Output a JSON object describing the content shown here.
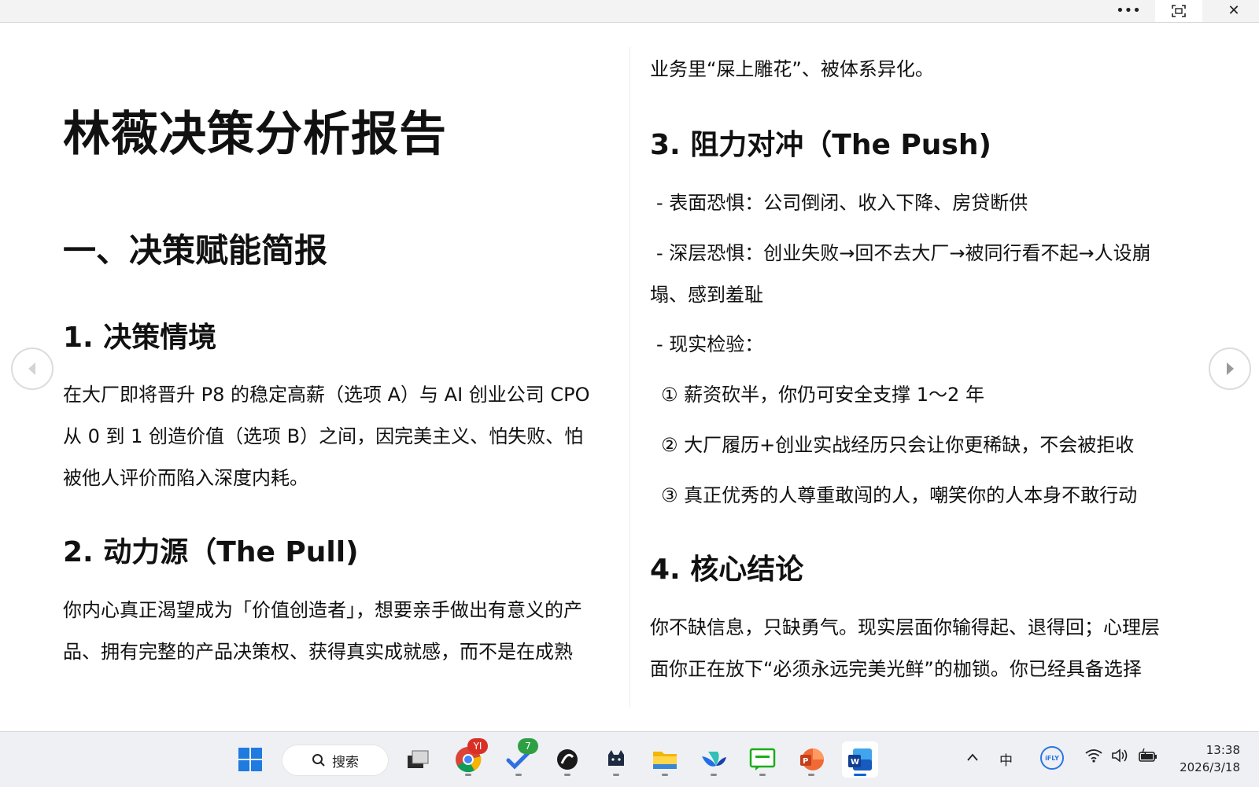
{
  "window": {
    "more_glyph": "•••",
    "fullscreen_glyph": "⛶",
    "close_glyph": "✕"
  },
  "left_page": {
    "title": "林薇决策分析报告",
    "section_1": "一、决策赋能简报",
    "h_1": "1. 决策情境",
    "p_1": [
      "在大厂即将晋升 P8 的稳定高薪（选项 A）与 AI 创业公司 CPO",
      "从 0 到 1 创造价值（选项 B）之间，因完美主义、怕失败、怕",
      "被他人评价而陷入深度内耗。"
    ],
    "h_2": "2. 动力源（The Pull)",
    "p_2": [
      "你内心真正渴望成为「价值创造者」，想要亲手做出有意义的产",
      "品、拥有完整的产品决策权、获得真实成就感，而不是在成熟"
    ]
  },
  "right_page": {
    "p_cont": "业务里“屎上雕花”、被体系异化。",
    "h_3": "3. 阻力对冲（The Push)",
    "items": [
      "- 表面恐惧：公司倒闭、收入下降、房贷断供",
      "- 深层恐惧：创业失败→回不去大厂→被同行看不起→人设崩",
      "塌、感到羞耻",
      "- 现实检验：",
      "① 薪资砍半，你仍可安全支撑 1～2 年",
      "② 大厂履历+创业实战经历只会让你更稀缺，不会被拒收",
      "③ 真正优秀的人尊重敢闯的人，嘲笑你的人本身不敢行动"
    ],
    "h_4": "4. 核心结论",
    "p_4": [
      "你不缺信息，只缺勇气。现实层面你输得起、退得回；心理层",
      "面你正在放下“必须永远完美光鲜”的枷锁。你已经具备选择"
    ]
  },
  "taskbar": {
    "search_label": "搜索",
    "chrome_badge": "YI",
    "todo_badge": "7",
    "tray_chevron": "^",
    "ime_label": "中",
    "ifly_label": "iFLY",
    "time": "13:38",
    "date": "2026/3/18"
  },
  "colors": {
    "accent_blue": "#0a64d8",
    "chrome_badge_bg": "#d93025",
    "todo_badge_bg": "#2ea043"
  }
}
